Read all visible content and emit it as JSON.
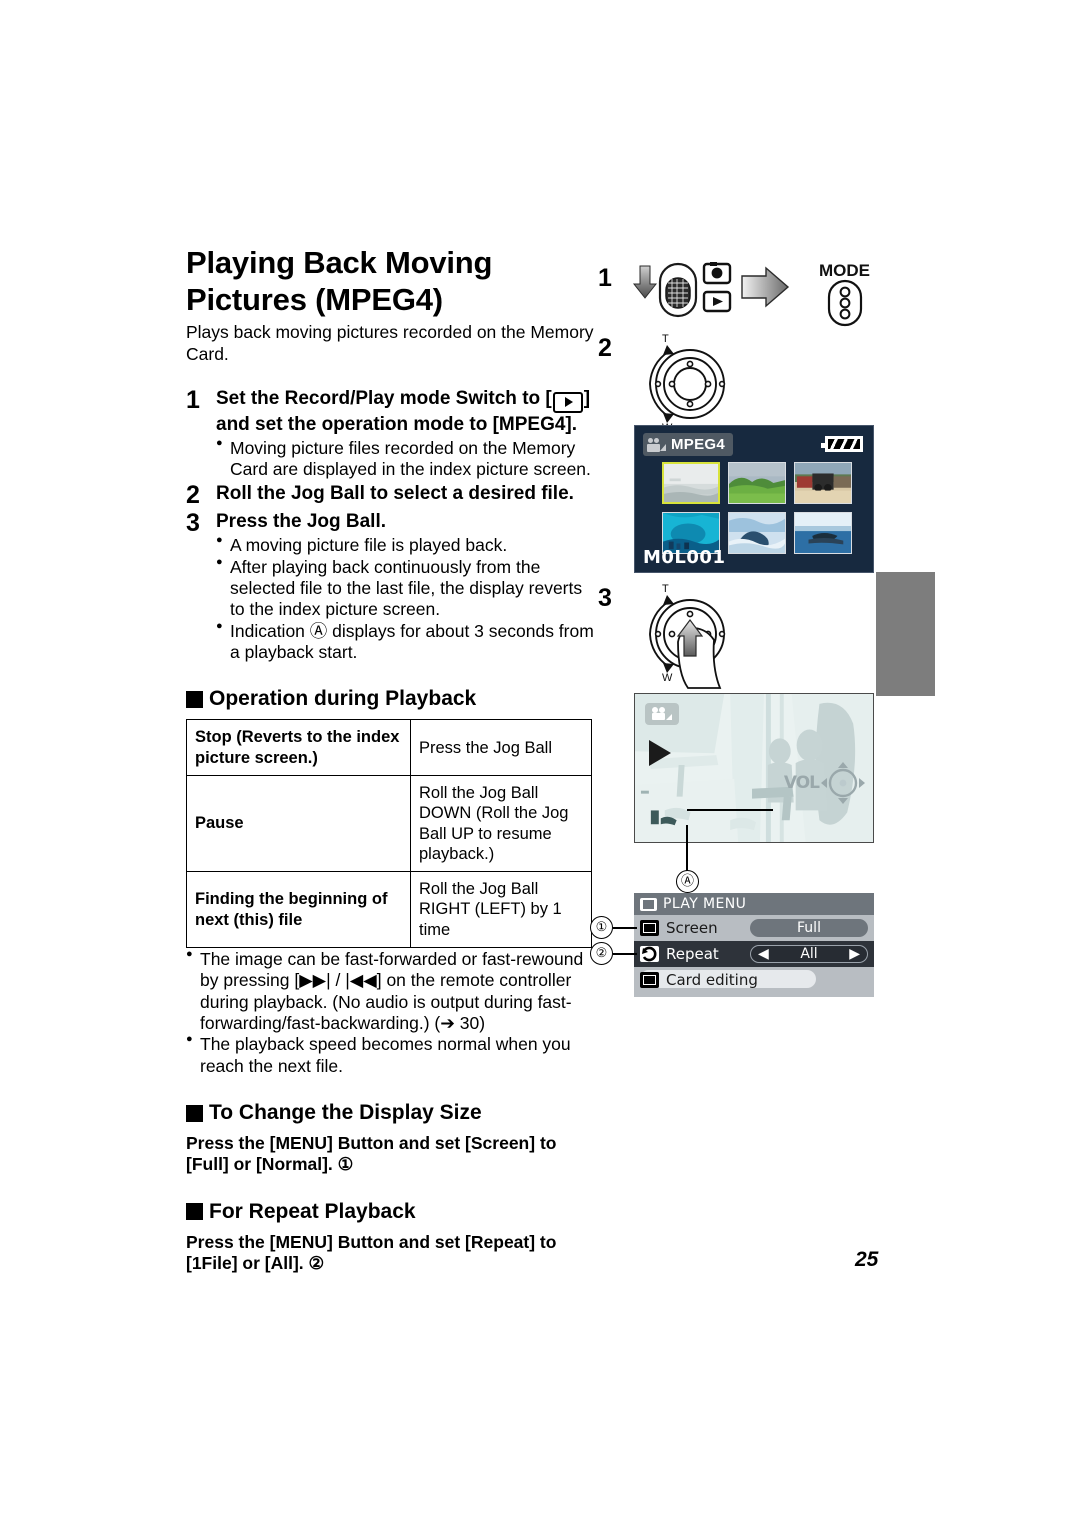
{
  "page": {
    "number": "25"
  },
  "heading": {
    "title_line1": "Playing Back Moving",
    "title_line2": "Pictures (MPEG4)",
    "intro": "Plays back moving pictures recorded on the Memory Card."
  },
  "steps": [
    {
      "num": "1",
      "text_before_icon": "Set the Record/Play mode Switch to [",
      "icon": "play-icon",
      "text_after_icon": "] and set the operation mode to [MPEG4].",
      "bullets": [
        "Moving picture files recorded on the Memory Card are displayed in the index picture screen."
      ]
    },
    {
      "num": "2",
      "text": "Roll the Jog Ball to select a desired file.",
      "bullets": []
    },
    {
      "num": "3",
      "text": "Press the Jog Ball.",
      "bullets": [
        "A moving picture file is played back.",
        "After playing back continuously from the selected file to the last file, the display reverts to the index picture screen.",
        "Indication Ⓐ displays for about 3 seconds from a playback start."
      ]
    }
  ],
  "section_operation": {
    "title": "Operation during Playback",
    "table": {
      "rows": [
        {
          "key": "Stop (Reverts to the index picture screen.)",
          "value": "Press the Jog Ball"
        },
        {
          "key": "Pause",
          "value": "Roll the Jog Ball DOWN (Roll the Jog Ball UP to resume playback.)"
        },
        {
          "key": "Finding the beginning of next (this) file",
          "value": "Roll the Jog Ball RIGHT (LEFT) by 1 time"
        }
      ]
    },
    "notes": [
      "The image can be fast-forwarded or fast-rewound by pressing [▶▶| / |◀◀] on the remote controller during playback. (No audio is output during fast-forwarding/fast-backwarding.) (➔ 30)",
      "The playback speed becomes normal when you reach the next file."
    ]
  },
  "section_display_size": {
    "title": "To Change the Display Size",
    "body": "Press the [MENU] Button and set [Screen] to [Full] or [Normal]. ①"
  },
  "section_repeat": {
    "title": "For Repeat Playback",
    "body": "Press the [MENU] Button and set [Repeat] to [1File] or [All]. ②"
  },
  "illustrations": {
    "step1_label": "1",
    "step2_label": "2",
    "step3_label": "3",
    "mode_label": "MODE",
    "zoom_t": "T",
    "zoom_w": "W",
    "zoom_t2": "T",
    "zoom_w2": "W"
  },
  "lcd_index": {
    "mode_badge": "MPEG4",
    "file_name": "M0L001",
    "battery_icon": "battery-icon",
    "thumbnails": [
      {
        "id": "thumb-1",
        "selected": true,
        "top": "#e8eaea",
        "bottom": "#cfd6d6"
      },
      {
        "id": "thumb-2",
        "selected": false,
        "top": "#b9c6cf",
        "bottom": "#6fae3f"
      },
      {
        "id": "thumb-3",
        "selected": false,
        "top": "#8fa7b8",
        "bottom": "#c39a69"
      },
      {
        "id": "thumb-4",
        "selected": false,
        "top": "#1eb9d6",
        "bottom": "#0a5f8a"
      },
      {
        "id": "thumb-5",
        "selected": false,
        "top": "#bcd4e6",
        "bottom": "#2b5f86"
      },
      {
        "id": "thumb-6",
        "selected": false,
        "top": "#dcebf4",
        "bottom": "#2d6fa5"
      }
    ]
  },
  "lcd_playback": {
    "play_icon": "play-triangle-icon",
    "camera_icon": "camcorder-icon",
    "volume_label": "VOL",
    "callout": "Ⓐ"
  },
  "play_menu": {
    "title": "PLAY MENU",
    "rows": [
      {
        "callout": "①",
        "icon": "screen-icon",
        "label": "Screen",
        "value": "Full",
        "active": false,
        "arrows": false
      },
      {
        "callout": "②",
        "icon": "repeat-icon",
        "label": "Repeat",
        "value": "All",
        "active": true,
        "arrows": true
      },
      {
        "callout": "",
        "icon": "card-icon",
        "label": "Card editing",
        "value": "",
        "active": false,
        "arrows": false
      }
    ]
  },
  "colors": {
    "lcd_background": "#17293f",
    "selected_border": "#d8e33c",
    "menu_background": "#b8bdc2",
    "menu_title_bar": "#6e757c",
    "side_tab": "#7d7d7d"
  }
}
